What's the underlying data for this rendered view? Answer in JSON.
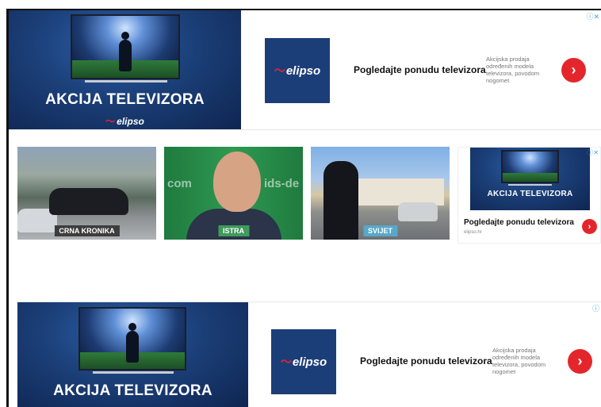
{
  "ad_top": {
    "promo_title": "AKCIJA TELEVIZORA",
    "brand": "elipso",
    "headline": "Pogledajte ponudu televizora",
    "description": "Akcijska prodaja određenih modela televizora, povodom nogomet",
    "cta_icon": "chevron-right-icon",
    "adchoices_label": "ⓘ✕"
  },
  "news_cards": [
    {
      "tag": "CRNA KRONIKA",
      "tag_color": "#3d3d3d"
    },
    {
      "tag": "ISTRA",
      "tag_color": "#3f9a5c",
      "watermark_left": "com",
      "watermark_right": "ids-de"
    },
    {
      "tag": "SVIJET",
      "tag_color": "#58a8c8"
    }
  ],
  "ad_side": {
    "promo_title": "AKCIJA TELEVIZORA",
    "headline": "Pogledajte ponudu televizora",
    "url": "elipso.hr",
    "adchoices_label": "ⓘ✕"
  },
  "ad_bottom": {
    "promo_title": "AKCIJA TELEVIZORA",
    "brand": "elipso",
    "headline": "Pogledajte ponudu televizora",
    "description": "Akcijska prodaja određenih modela televizora, povodom nogomet",
    "adchoices_label": "ⓘ"
  },
  "colors": {
    "accent_red": "#e4262c",
    "brand_navy": "#1c3e78"
  }
}
